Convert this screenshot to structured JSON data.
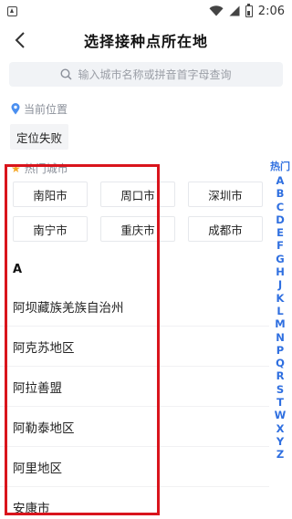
{
  "status_bar": {
    "time": "2:06"
  },
  "header": {
    "title": "选择接种点所在地"
  },
  "search": {
    "placeholder": "输入城市名称或拼音首字母查询"
  },
  "current_location": {
    "label": "当前位置",
    "button_label": "定位失败"
  },
  "hot_cities": {
    "label": "热门城市",
    "items": [
      "南阳市",
      "周口市",
      "深圳市",
      "南宁市",
      "重庆市",
      "成都市"
    ]
  },
  "city_list": {
    "section_letter": "A",
    "items": [
      "阿坝藏族羌族自治州",
      "阿克苏地区",
      "阿拉善盟",
      "阿勒泰地区",
      "阿里地区",
      "安康市"
    ]
  },
  "index_bar": {
    "hot_label": "热门",
    "letters": [
      "A",
      "B",
      "C",
      "D",
      "E",
      "F",
      "G",
      "H",
      "J",
      "K",
      "L",
      "M",
      "N",
      "P",
      "Q",
      "R",
      "S",
      "T",
      "W",
      "X",
      "Y",
      "Z"
    ]
  },
  "colors": {
    "accent_blue": "#2f6fe0",
    "highlight_red": "#d9141c",
    "star_orange": "#f5a623"
  }
}
